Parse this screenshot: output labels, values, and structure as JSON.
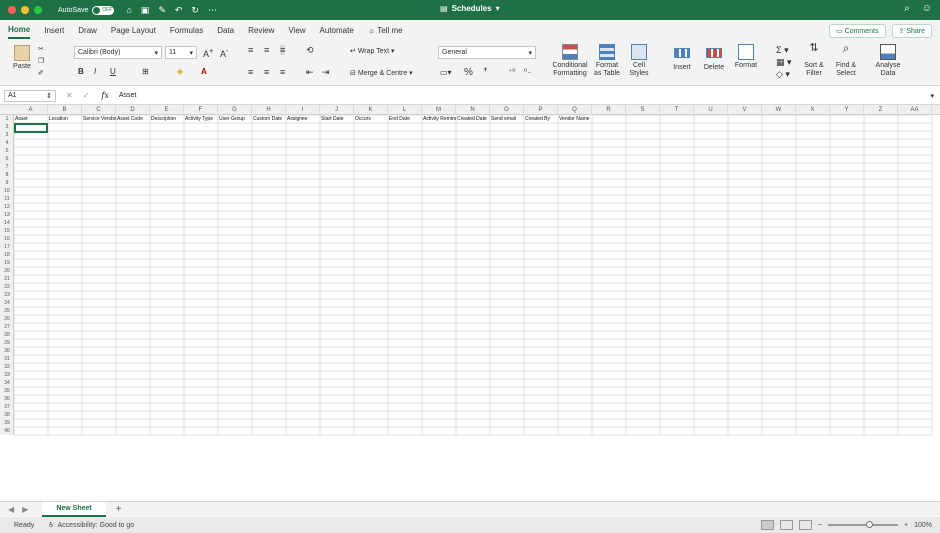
{
  "titlebar": {
    "autosave_label": "AutoSave",
    "autosave_state": "OFF",
    "doc_title": "Schedules"
  },
  "ribbon_tabs": [
    "Home",
    "Insert",
    "Draw",
    "Page Layout",
    "Formulas",
    "Data",
    "Review",
    "View",
    "Automate"
  ],
  "tell_me": "Tell me",
  "comments_label": "Comments",
  "share_label": "Share",
  "ribbon": {
    "paste": "Paste",
    "font_name": "Calibri (Body)",
    "font_size": "11",
    "wrap_text": "Wrap Text",
    "merge_centre": "Merge & Centre",
    "number_format": "General",
    "conditional_formatting": [
      "Conditional",
      "Formatting"
    ],
    "format_as_table": [
      "Format",
      "as Table"
    ],
    "cell_styles": [
      "Cell",
      "Styles"
    ],
    "insert": "Insert",
    "delete": "Delete",
    "format": "Format",
    "sort_filter": [
      "Sort &",
      "Filter"
    ],
    "find_select": [
      "Find &",
      "Select"
    ],
    "analyse_data": [
      "Analyse",
      "Data"
    ]
  },
  "formula_bar": {
    "name_box": "A1",
    "fx": "fx",
    "value": "Asset"
  },
  "columns": [
    "A",
    "B",
    "C",
    "D",
    "E",
    "F",
    "G",
    "H",
    "I",
    "J",
    "K",
    "L",
    "M",
    "N",
    "O",
    "P",
    "Q",
    "R",
    "S",
    "T",
    "U",
    "V",
    "W",
    "X",
    "Y",
    "Z",
    "AA"
  ],
  "rows": [
    "1",
    "2",
    "3",
    "4",
    "5",
    "6",
    "7",
    "8",
    "9",
    "10",
    "11",
    "12",
    "13",
    "14",
    "15",
    "16",
    "17",
    "18",
    "19",
    "20",
    "21",
    "22",
    "23",
    "24",
    "25",
    "26",
    "27",
    "28",
    "29",
    "30",
    "31",
    "32",
    "33",
    "34",
    "35",
    "36",
    "37",
    "38",
    "39",
    "40"
  ],
  "header_cells": [
    "Asset",
    "Location",
    "Service Vendor",
    "Asset Code",
    "Description",
    "Activity Type",
    "User Group",
    "Custom Date",
    "Assignee",
    "Start Date",
    "Occurs",
    "End Date",
    "Activity Reminder",
    "Created Date",
    "Send email",
    "Created By",
    "Vendor Name"
  ],
  "sheet_tab": "New Sheet",
  "status": {
    "ready": "Ready",
    "accessibility": "Accessibility: Good to go",
    "zoom": "100%"
  }
}
